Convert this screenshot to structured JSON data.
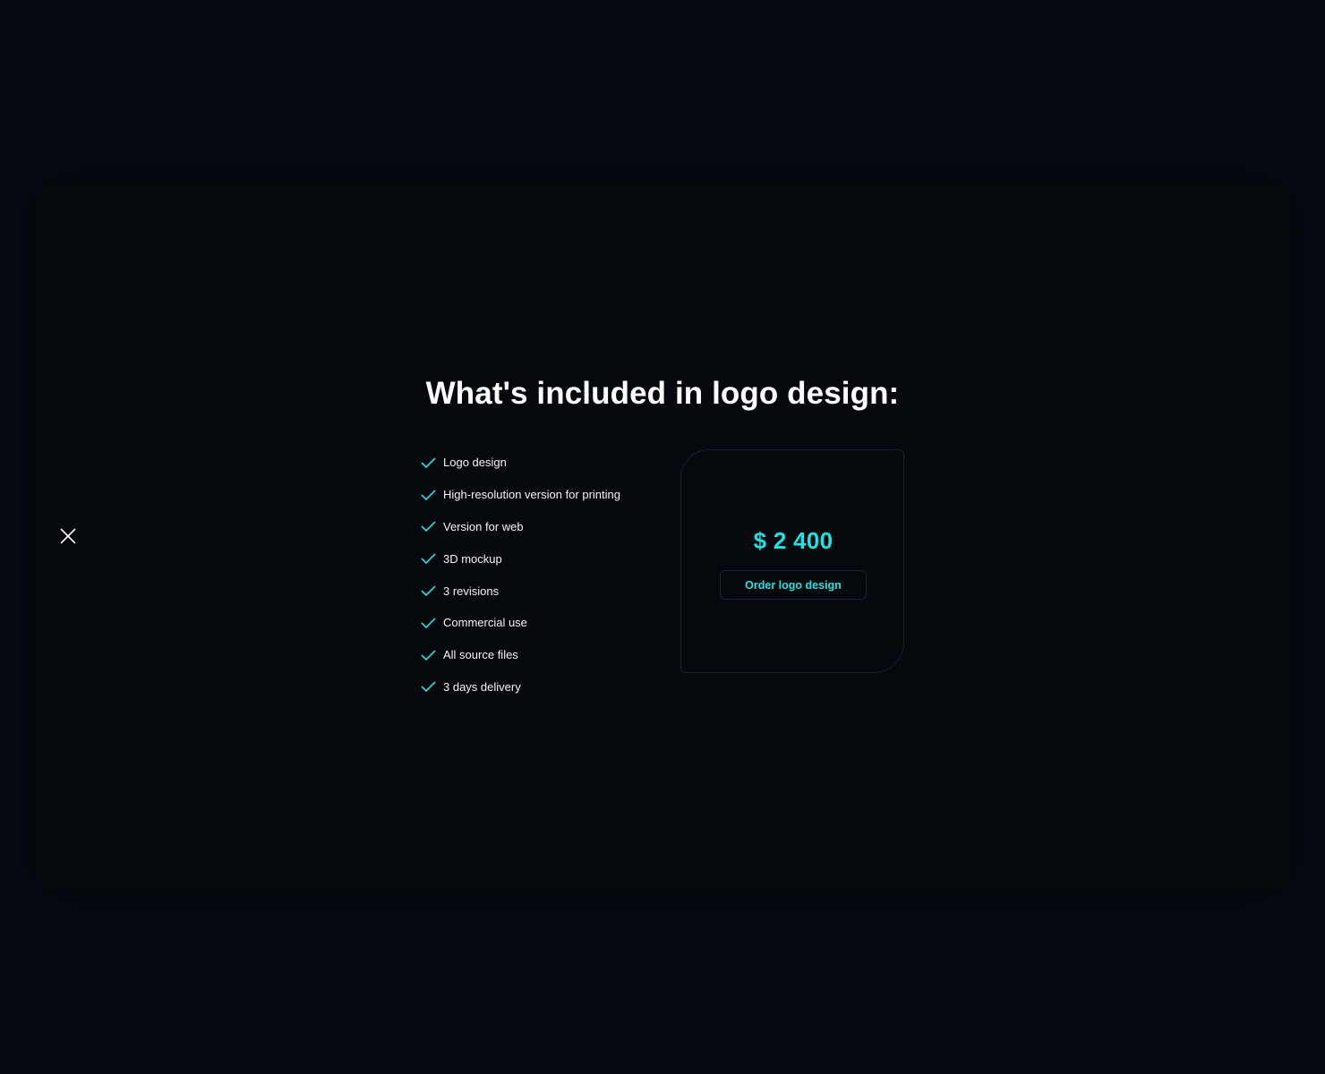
{
  "modal": {
    "title": "What's included in logo design:",
    "close_icon": "close-icon",
    "features": [
      "Logo design",
      "High-resolution version for printing",
      "Version for web",
      "3D mockup",
      "3 revisions",
      "Commercial use",
      "All source files",
      "3 days delivery"
    ],
    "feature_icon": "check-icon",
    "price_card": {
      "price": "$ 2 400",
      "order_button_label": "Order logo design"
    }
  },
  "colors": {
    "background": "#060a11",
    "modal_background": "#05080d",
    "accent": "#1ee3e0",
    "text": "#ffffff",
    "border": "#1a2230"
  }
}
